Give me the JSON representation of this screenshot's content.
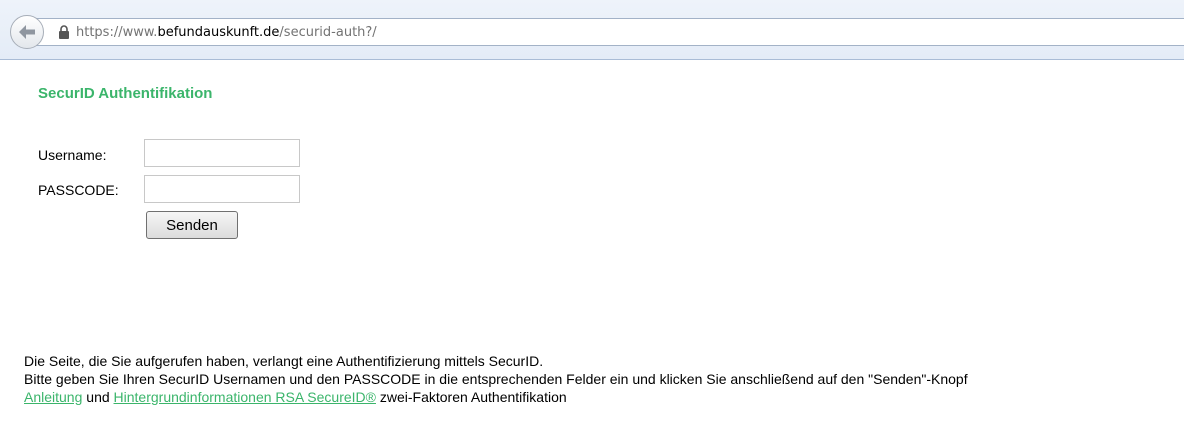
{
  "browser": {
    "url_prefix": "https://www.",
    "url_host": "befundauskunft.de",
    "url_path": "/securid-auth?/"
  },
  "page": {
    "title": "SecurID Authentifikation"
  },
  "form": {
    "username_label": "Username:",
    "username_value": "",
    "passcode_label": "PASSCODE:",
    "passcode_value": "",
    "submit_label": "Senden"
  },
  "info": {
    "line1": "Die Seite, die Sie aufgerufen haben, verlangt eine Authentifizierung mittels SecurID.",
    "line2": "Bitte geben Sie Ihren SecurID Usernamen und den PASSCODE in die entsprechenden Felder ein und klicken Sie anschließend auf den \"Senden\"-Knopf",
    "link1": "Anleitung",
    "connector": " und ",
    "link2": "Hintergrundinformationen RSA SecureID®",
    "suffix": " zwei-Faktoren Authentifikation"
  },
  "colors": {
    "accent_green": "#3bb56b"
  }
}
